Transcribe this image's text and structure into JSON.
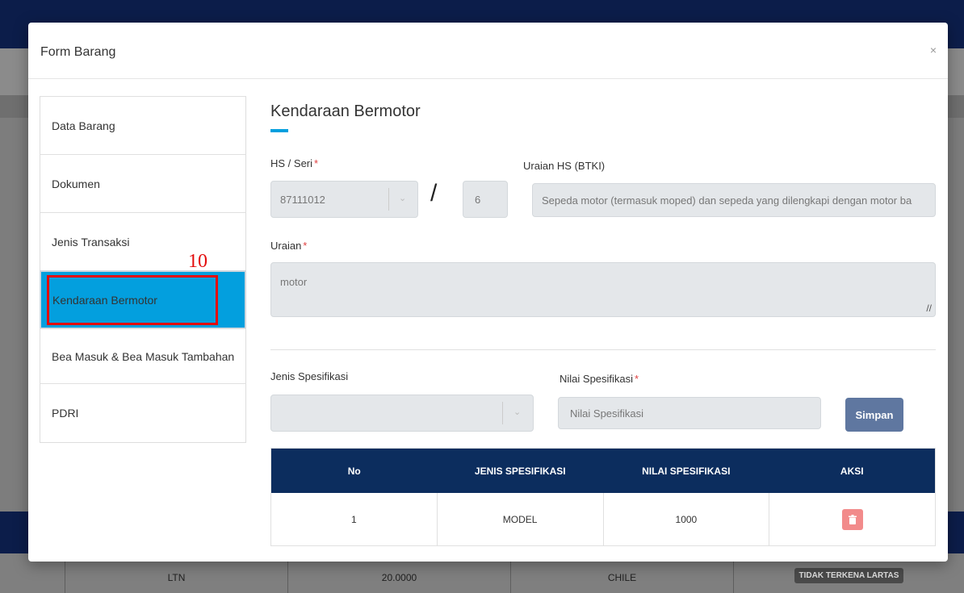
{
  "background": {
    "row": [
      "",
      "LTN",
      "20.0000",
      "CHILE",
      "TIDAK TERKENA LARTAS"
    ]
  },
  "modal": {
    "title": "Form Barang",
    "close": "×"
  },
  "sidebar": {
    "items": [
      {
        "label": "Data Barang"
      },
      {
        "label": "Dokumen"
      },
      {
        "label": "Jenis Transaksi"
      },
      {
        "label": "Kendaraan Bermotor"
      },
      {
        "label": "Bea Masuk & Bea Masuk Tambahan"
      },
      {
        "label": "PDRI"
      }
    ],
    "active_index": 3,
    "annotation_number": "10"
  },
  "form": {
    "section_title": "Kendaraan Bermotor",
    "hs_label": "HS / Seri",
    "hs_value": "87111012",
    "seri_value": "6",
    "uraian_hs_label": "Uraian HS (BTKI)",
    "uraian_hs_value": "Sepeda motor (termasuk moped) dan sepeda yang dilengkapi dengan motor ba",
    "uraian_label": "Uraian",
    "uraian_value": "motor",
    "jenis_spesifikasi_label": "Jenis Spesifikasi",
    "jenis_spesifikasi_value": "",
    "nilai_spesifikasi_label": "Nilai Spesifikasi",
    "nilai_spesifikasi_placeholder": "Nilai Spesifikasi",
    "required_mark": "*",
    "slash": "/",
    "save_label": "Simpan"
  },
  "table": {
    "headers": [
      "No",
      "JENIS SPESIFIKASI",
      "NILAI SPESIFIKASI",
      "AKSI"
    ],
    "rows": [
      {
        "no": "1",
        "jenis": "MODEL",
        "nilai": "1000"
      }
    ]
  },
  "colors": {
    "accent": "#039fde",
    "navy": "#0c2d5e",
    "button": "#5f77a0",
    "delete": "#f28b8b",
    "annotation": "#e30b0b"
  }
}
